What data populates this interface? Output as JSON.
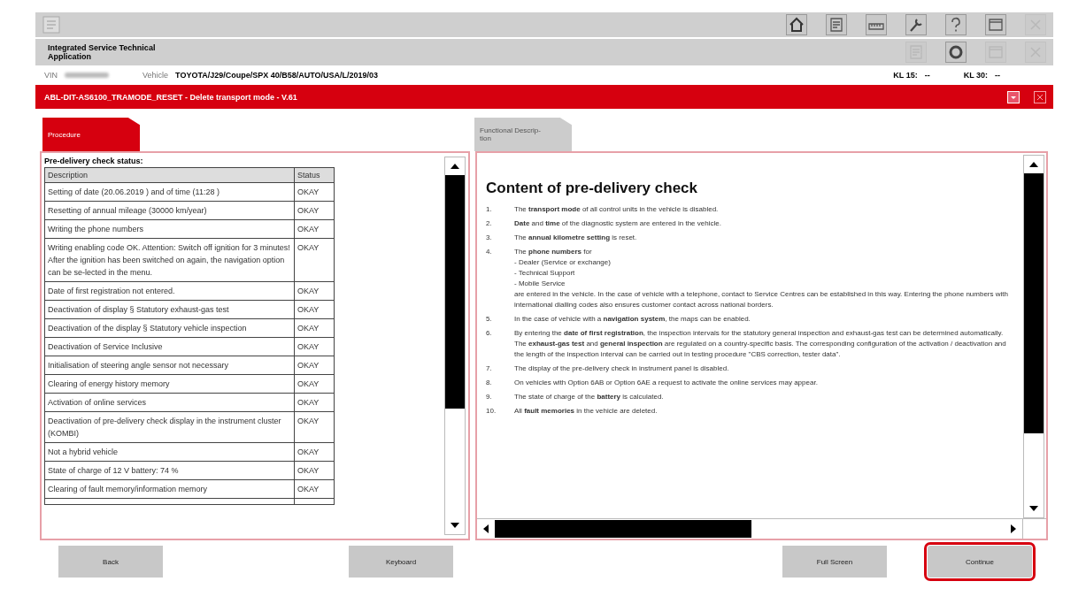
{
  "toolbar": {
    "icons": [
      {
        "kind": "home",
        "disabled": false
      },
      {
        "kind": "document",
        "disabled": false
      },
      {
        "kind": "gauge",
        "disabled": false
      },
      {
        "kind": "wrench",
        "disabled": false
      },
      {
        "kind": "help",
        "disabled": false
      },
      {
        "kind": "window",
        "disabled": false
      },
      {
        "kind": "close",
        "disabled": true
      }
    ]
  },
  "app_bar": {
    "title": "Integrated Service Technical Application",
    "icons": [
      {
        "kind": "document",
        "disabled": true
      },
      {
        "kind": "gear",
        "disabled": false
      },
      {
        "kind": "window",
        "disabled": true
      },
      {
        "kind": "close",
        "disabled": true
      }
    ]
  },
  "vehicle_bar": {
    "vin_label": "VIN",
    "vehicle_label": "Vehicle",
    "vehicle": "TOYOTA/J29/Coupe/SPX 40/B58/AUTO/USA/L/2019/03",
    "kl15_label": "KL 15:",
    "kl15": "--",
    "kl30_label": "KL 30:",
    "kl30": "--"
  },
  "procedure_bar": {
    "title": "ABL-DIT-AS6100_TRAMODE_RESET - Delete transport mode - V.61"
  },
  "tabs": [
    {
      "label": "Procedure",
      "selected": true
    },
    {
      "label": "Functional Descrip-tion",
      "selected": false
    }
  ],
  "left_panel": {
    "title": "Pre-delivery check status:",
    "columns": [
      "Description",
      "Status"
    ],
    "rows": [
      {
        "description": "Setting of date (20.06.2019 ) and of time (11:28 )",
        "status": "OKAY"
      },
      {
        "description": "Resetting of annual mileage (30000  km/year)",
        "status": "OKAY"
      },
      {
        "description": "Writing the phone numbers",
        "status": "OKAY"
      },
      {
        "description": "Writing enabling code OK. Attention: Switch off ignition for 3 minutes! After the ignition has been switched on again, the navigation option can be se-lected in the menu.",
        "status": "OKAY"
      },
      {
        "description": "Date of first registration not entered.",
        "status": "OKAY"
      },
      {
        "description": "Deactivation of display § Statutory exhaust-gas test",
        "status": "OKAY"
      },
      {
        "description": "Deactivation of the display § Statutory vehicle inspection",
        "status": "OKAY"
      },
      {
        "description": "Deactivation of Service Inclusive",
        "status": "OKAY"
      },
      {
        "description": "Initialisation of steering angle sensor not necessary",
        "status": "OKAY"
      },
      {
        "description": "Clearing of energy history memory",
        "status": "OKAY"
      },
      {
        "description": "Activation of online services",
        "status": "OKAY"
      },
      {
        "description": "Deactivation of pre-delivery check display in the instrument cluster (KOMBI)",
        "status": "OKAY"
      },
      {
        "description": "Not a hybrid vehicle",
        "status": "OKAY"
      },
      {
        "description": "State of charge of 12 V battery: 74 %",
        "status": "OKAY"
      },
      {
        "description": "Clearing of fault memory/information memory",
        "status": "OKAY"
      }
    ]
  },
  "right_panel": {
    "heading": "Content of pre-delivery check",
    "items": [
      {
        "number": "1.",
        "paragraphs": [
          "The **transport mode** of all control units in the vehicle is disabled."
        ]
      },
      {
        "number": "2.",
        "paragraphs": [
          "**Date** and **time** of the diagnostic system are entered in the vehicle."
        ]
      },
      {
        "number": "3.",
        "paragraphs": [
          "The **annual kilometre setting** is reset."
        ]
      },
      {
        "number": "4.",
        "paragraphs": [
          "The **phone numbers** for",
          "- Dealer (Service or exchange)",
          "- Technical Support",
          "- Mobile Service",
          "are entered in the vehicle. In the case of vehicle with a telephone, contact to Service Centres can be established in this way. Entering the phone numbers with international dialling codes also ensures customer contact across national borders."
        ]
      },
      {
        "number": "5.",
        "paragraphs": [
          "In the case of vehicle with a **navigation system**, the maps can be enabled."
        ]
      },
      {
        "number": "6.",
        "paragraphs": [
          "By entering the **date of first registration**, the inspection intervals for the statutory general inspection and exhaust-gas test can be determined automatically.",
          "The **exhaust-gas test** and **general inspection** are regulated on a country-specific basis. The corresponding configuration of the activation / deactivation and the length of the inspection interval can be carried out in testing procedure \"CBS correction, tester data\"."
        ]
      },
      {
        "number": "7.",
        "paragraphs": [
          "The display of the pre-delivery check in instrument panel is disabled."
        ]
      },
      {
        "number": "8.",
        "paragraphs": [
          "On vehicles with Option 6AB or Option 6AE a request to activate the online services may appear."
        ]
      },
      {
        "number": "9.",
        "paragraphs": [
          "The state of charge of the **battery** is calculated."
        ]
      },
      {
        "number": "10.",
        "paragraphs": [
          "All **fault memories** in the vehicle are deleted."
        ]
      }
    ]
  },
  "buttons": [
    {
      "label": "Back",
      "highlighted": false
    },
    {
      "label": "Keyboard",
      "highlighted": false
    },
    {
      "label": "Full Screen",
      "highlighted": false
    },
    {
      "label": "Continue",
      "highlighted": true
    }
  ]
}
